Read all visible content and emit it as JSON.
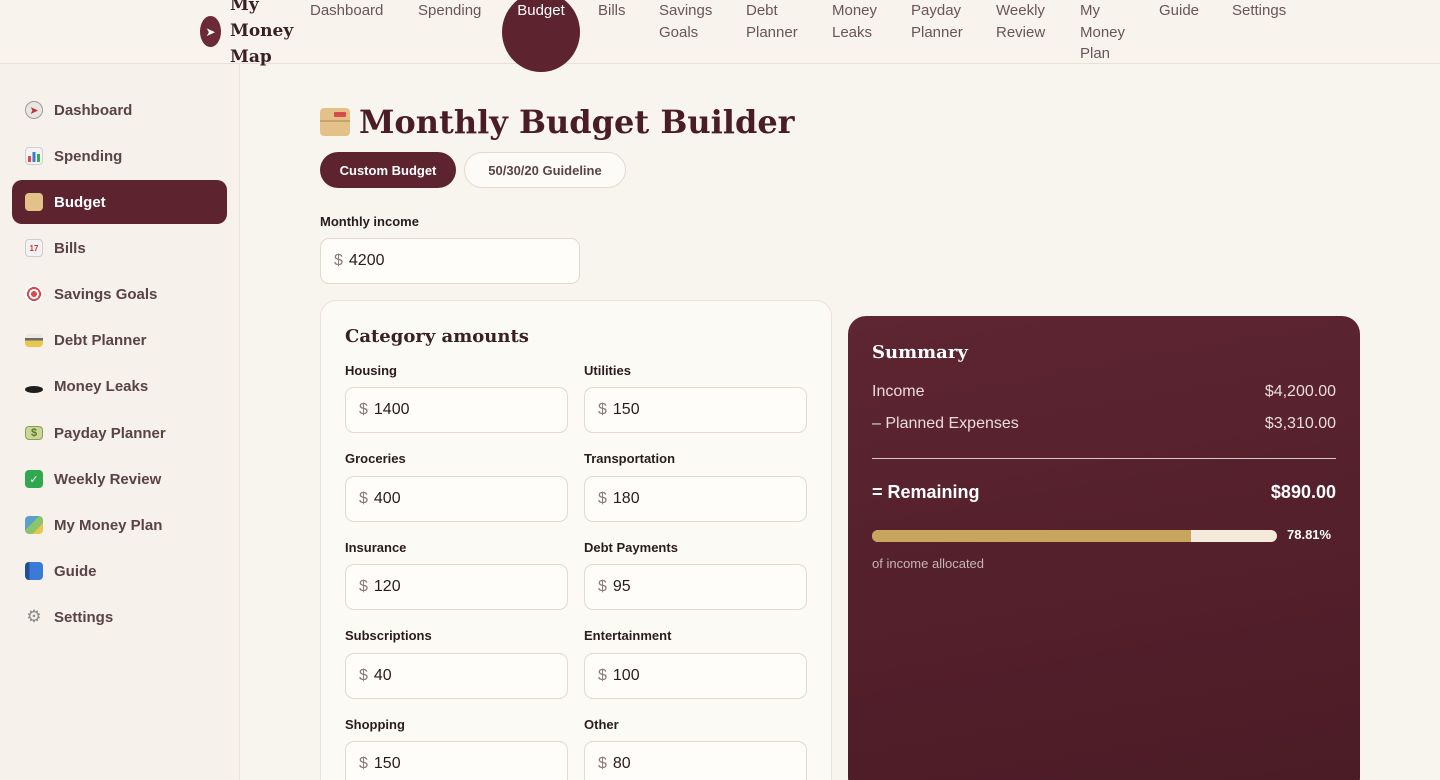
{
  "brand": {
    "name_line1": "My",
    "name_line2": "Money",
    "name_line3": "Map",
    "logo_icon": "compass-icon"
  },
  "topnav": {
    "items": [
      {
        "line1": "Dashboard",
        "line2": "",
        "line3": ""
      },
      {
        "line1": "Spending",
        "line2": "",
        "line3": ""
      },
      {
        "line1": "Budget",
        "line2": "",
        "line3": ""
      },
      {
        "line1": "Bills",
        "line2": "",
        "line3": ""
      },
      {
        "line1": "Savings",
        "line2": "Goals",
        "line3": ""
      },
      {
        "line1": "Debt",
        "line2": "Planner",
        "line3": ""
      },
      {
        "line1": "Money",
        "line2": "Leaks",
        "line3": ""
      },
      {
        "line1": "Payday",
        "line2": "Planner",
        "line3": ""
      },
      {
        "line1": "Weekly",
        "line2": "Review",
        "line3": ""
      },
      {
        "line1": "My",
        "line2": "Money",
        "line3": "Plan"
      },
      {
        "line1": "Guide",
        "line2": "",
        "line3": ""
      },
      {
        "line1": "Settings",
        "line2": "",
        "line3": ""
      }
    ],
    "active": "Budget"
  },
  "sidebar": {
    "items": [
      {
        "label": "Dashboard",
        "icon": "compass-icon",
        "color": "#8a8a8a"
      },
      {
        "label": "Spending",
        "icon": "bar-chart-icon",
        "color": "#4a7bd1"
      },
      {
        "label": "Budget",
        "icon": "card-box-icon",
        "color": "#e3c28a"
      },
      {
        "label": "Bills",
        "icon": "calendar-icon",
        "color": "#d9d9d9"
      },
      {
        "label": "Savings Goals",
        "icon": "target-icon",
        "color": "#d94a4a"
      },
      {
        "label": "Debt Planner",
        "icon": "credit-card-icon",
        "color": "#e8c64f"
      },
      {
        "label": "Money Leaks",
        "icon": "hole-icon",
        "color": "#2a2a2a"
      },
      {
        "label": "Payday Planner",
        "icon": "money-icon",
        "color": "#a9c46a"
      },
      {
        "label": "Weekly Review",
        "icon": "check-mark-icon",
        "color": "#2fa84f"
      },
      {
        "label": "My Money Plan",
        "icon": "map-icon",
        "color": "#5aa0c8"
      },
      {
        "label": "Guide",
        "icon": "book-icon",
        "color": "#3a6fc4"
      },
      {
        "label": "Settings",
        "icon": "gear-icon",
        "color": "#9a9a9a"
      }
    ],
    "active": "Budget"
  },
  "page": {
    "title": "Monthly Budget Builder",
    "title_icon": "card-box-icon"
  },
  "tabs": {
    "custom": "Custom Budget",
    "guideline": "50/30/20 Guideline",
    "active": "Custom Budget"
  },
  "income": {
    "label": "Monthly income",
    "currency": "$",
    "value": "4200"
  },
  "categories": {
    "title": "Category amounts",
    "items": [
      {
        "label": "Housing",
        "value": "1400"
      },
      {
        "label": "Utilities",
        "value": "150"
      },
      {
        "label": "Groceries",
        "value": "400"
      },
      {
        "label": "Transportation",
        "value": "180"
      },
      {
        "label": "Insurance",
        "value": "120"
      },
      {
        "label": "Debt Payments",
        "value": "95"
      },
      {
        "label": "Subscriptions",
        "value": "40"
      },
      {
        "label": "Entertainment",
        "value": "100"
      },
      {
        "label": "Shopping",
        "value": "150"
      },
      {
        "label": "Other",
        "value": "80"
      }
    ]
  },
  "summary": {
    "title": "Summary",
    "income_label": "Income",
    "income_value": "$4,200.00",
    "expenses_label": "– Planned Expenses",
    "expenses_value": "$3,310.00",
    "remaining_label": "= Remaining",
    "remaining_value": "$890.00",
    "allocated_percent_text": "78.81%",
    "allocated_fraction": 0.7881,
    "allocated_caption": "of income allocated"
  },
  "colors": {
    "accent": "#5d232f",
    "background": "#f8f4ee",
    "progress": "#c8a55c"
  }
}
